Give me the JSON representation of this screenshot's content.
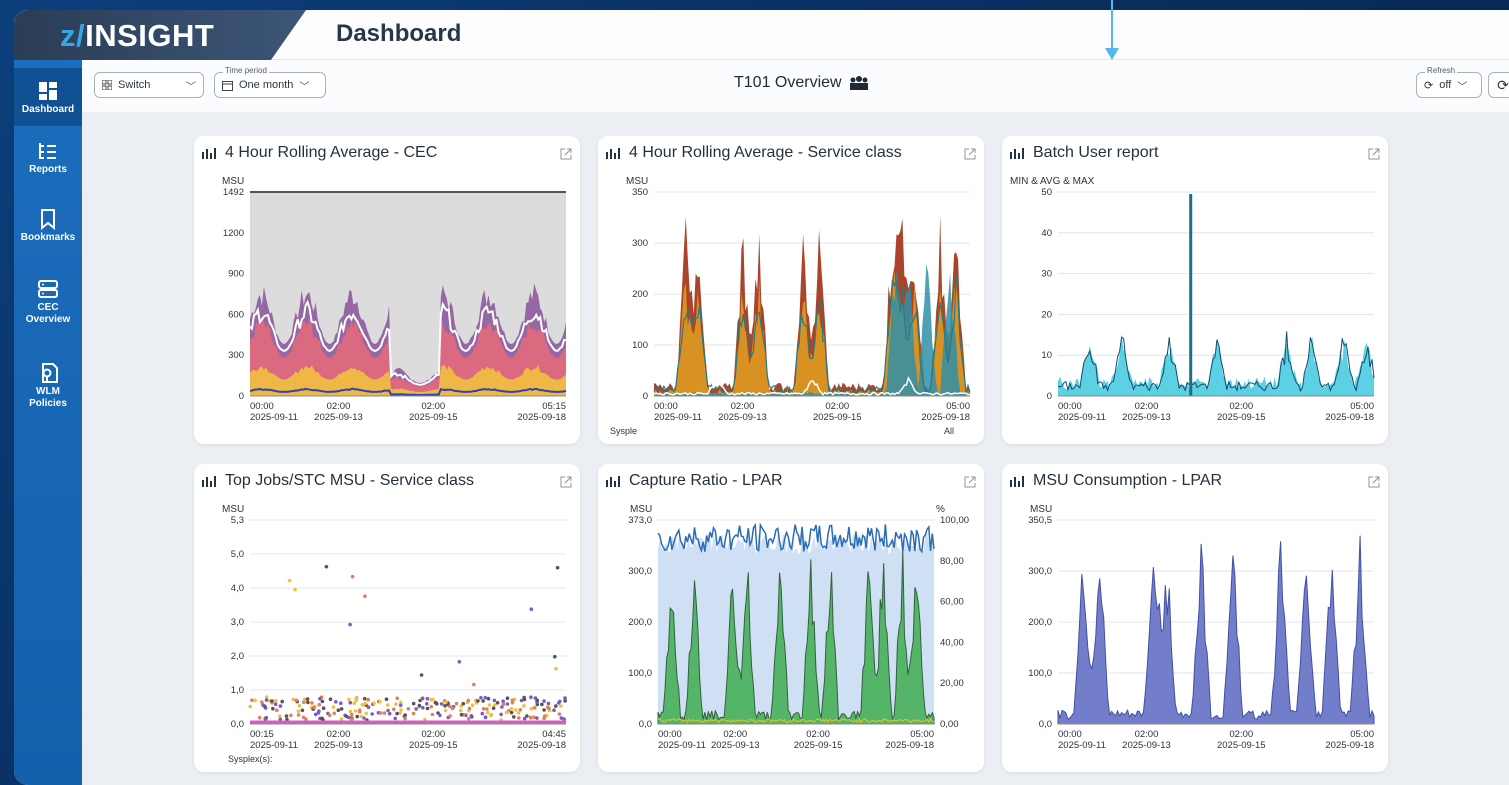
{
  "app": {
    "brand_prefix": "z/",
    "brand_name": "INSIGHT",
    "page_title": "Dashboard"
  },
  "sidebar": {
    "items": [
      {
        "label": "Dashboard",
        "icon": "dashboard-icon"
      },
      {
        "label": "Reports",
        "icon": "reports-icon"
      },
      {
        "label": "Bookmarks",
        "icon": "bookmark-icon"
      },
      {
        "label": "CEC Overview",
        "line1": "CEC",
        "line2": "Overview",
        "icon": "server-icon"
      },
      {
        "label": "WLM Policies",
        "line1": "WLM",
        "line2": "Policies",
        "icon": "policy-icon"
      }
    ]
  },
  "toolbar": {
    "switch_label": "Switch",
    "time_period_caption": "Time period",
    "time_period_value": "One month",
    "overview_title": "T101 Overview",
    "refresh_caption": "Refresh",
    "refresh_value": "off"
  },
  "colors": {
    "accent": "#1b6dbd",
    "brand_light": "#37a6e5"
  },
  "cards": [
    {
      "title": "4 Hour Rolling Average - CEC",
      "unit": "MSU",
      "y_ticks": [
        "1492",
        "1200",
        "900",
        "600",
        "300",
        "0"
      ],
      "x_ticks": [
        {
          "t": "00:00",
          "d": "2025-09-11"
        },
        {
          "t": "02:00",
          "d": "2025-09-13"
        },
        {
          "t": "02:00",
          "d": "2025-09-15"
        },
        {
          "t": "05:15",
          "d": "2025-09-18"
        }
      ]
    },
    {
      "title": "4 Hour Rolling Average - Service class",
      "unit": "MSU",
      "y_ticks": [
        "350",
        "300",
        "200",
        "100",
        "0"
      ],
      "x_ticks": [
        {
          "t": "00:00",
          "d": "2025-09-11"
        },
        {
          "t": "02:00",
          "d": "2025-09-13"
        },
        {
          "t": "02:00",
          "d": "2025-09-15"
        },
        {
          "t": "05:00",
          "d": "2025-09-18"
        }
      ],
      "footer_left": "Sysple",
      "footer_right": "All"
    },
    {
      "title": "Batch User report",
      "unit": "MIN & AVG & MAX",
      "y_ticks": [
        "50",
        "40",
        "30",
        "20",
        "10",
        "0"
      ],
      "x_ticks": [
        {
          "t": "00:00",
          "d": "2025-09-11"
        },
        {
          "t": "02:00",
          "d": "2025-09-13"
        },
        {
          "t": "02:00",
          "d": "2025-09-15"
        },
        {
          "t": "05:00",
          "d": "2025-09-18"
        }
      ]
    },
    {
      "title": "Top Jobs/STC MSU - Service class",
      "unit": "MSU",
      "y_ticks": [
        "5,3",
        "5,0",
        "4,0",
        "3,0",
        "2,0",
        "1,0",
        "0,0"
      ],
      "x_ticks": [
        {
          "t": "00:15",
          "d": "2025-09-11"
        },
        {
          "t": "02:00",
          "d": "2025-09-13"
        },
        {
          "t": "02:00",
          "d": "2025-09-15"
        },
        {
          "t": "04:45",
          "d": "2025-09-18"
        }
      ],
      "footer_left": "Sysplex(s):"
    },
    {
      "title": "Capture Ratio - LPAR",
      "unit": "MSU",
      "unit_right": "%",
      "y_ticks": [
        "373,0",
        "300,0",
        "200,0",
        "100,0",
        "0,0"
      ],
      "y_ticks_right": [
        "100,00",
        "80,00",
        "60,00",
        "40,00",
        "20,00",
        "0,00"
      ],
      "x_ticks": [
        {
          "t": "00:00",
          "d": "2025-09-11"
        },
        {
          "t": "02:00",
          "d": "2025-09-13"
        },
        {
          "t": "02:00",
          "d": "2025-09-15"
        },
        {
          "t": "05:00",
          "d": "2025-09-18"
        }
      ]
    },
    {
      "title": "MSU Consumption - LPAR",
      "unit": "MSU",
      "y_ticks": [
        "350,5",
        "300,0",
        "200,0",
        "100,0",
        "0,0"
      ],
      "x_ticks": [
        {
          "t": "00:00",
          "d": "2025-09-11"
        },
        {
          "t": "02:00",
          "d": "2025-09-13"
        },
        {
          "t": "02:00",
          "d": "2025-09-15"
        },
        {
          "t": "05:00",
          "d": "2025-09-18"
        }
      ]
    }
  ]
}
